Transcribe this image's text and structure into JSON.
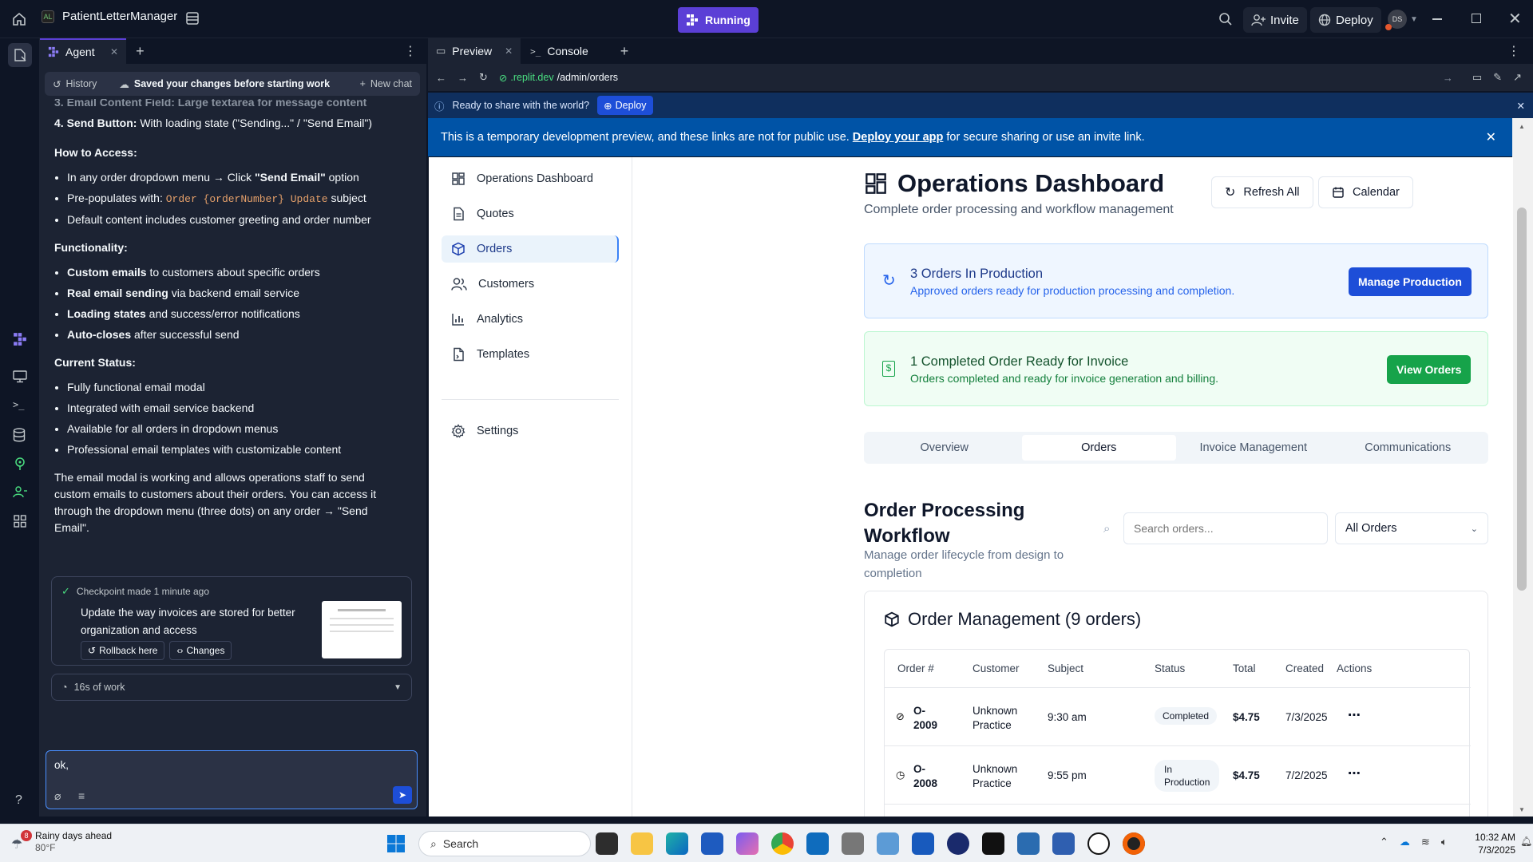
{
  "topbar": {
    "app_name": "PatientLetterManager",
    "running_label": "Running",
    "invite_label": "Invite",
    "deploy_label": "Deploy",
    "avatar_initials": "DS"
  },
  "agent": {
    "tab_label": "Agent",
    "history_label": "History",
    "saved_status": "Saved your changes before starting work",
    "new_chat_label": "New chat",
    "clipped_line": "3. Email Content Field: Large textarea for message content",
    "send_button_item_bold": "4. Send Button:",
    "send_button_item_rest": " With loading state (\"Sending...\" / \"Send Email\")",
    "how_to_access_heading": "How to Access:",
    "access_1_pre": "In any order dropdown menu → Click ",
    "access_1_bold": "\"Send Email\"",
    "access_1_post": " option",
    "access_2_pre": "Pre-populates with: ",
    "access_2_code": "Order {orderNumber} Update",
    "access_2_post": " subject",
    "access_3": "Default content includes customer greeting and order number",
    "functionality_heading": "Functionality:",
    "func_1_bold": "Custom emails",
    "func_1_rest": " to customers about specific orders",
    "func_2_bold": "Real email sending",
    "func_2_rest": " via backend email service",
    "func_3_bold": "Loading states",
    "func_3_rest": " and success/error notifications",
    "func_4_bold": "Auto-closes",
    "func_4_rest": " after successful send",
    "status_heading": "Current Status:",
    "status_1": "Fully functional email modal",
    "status_2": "Integrated with email service backend",
    "status_3": "Available for all orders in dropdown menus",
    "status_4": "Professional email templates with customizable content",
    "summary": "The email modal is working and allows operations staff to send custom emails to customers about their orders. You can access it through the dropdown menu (three dots) on any order → \"Send Email\".",
    "checkpoint_label": "Checkpoint made 1 minute ago",
    "checkpoint_desc": "Update the way invoices are stored for better organization and access",
    "rollback_label": "Rollback here",
    "changes_label": "Changes",
    "work_time": "16s of work",
    "input_value": "ok,"
  },
  "preview": {
    "preview_tab": "Preview",
    "console_tab": "Console",
    "url_domain": ".replit.dev",
    "url_path": "/admin/orders",
    "share_prompt": "Ready to share with the world?",
    "share_deploy": "Deploy",
    "banner_pre": "This is a temporary development preview, and these links are not for public use. ",
    "banner_link": "Deploy your app",
    "banner_post": " for secure sharing or use an invite link."
  },
  "app": {
    "nav": [
      "Operations Dashboard",
      "Quotes",
      "Orders",
      "Customers",
      "Analytics",
      "Templates"
    ],
    "settings_label": "Settings",
    "page_title": "Operations Dashboard",
    "page_subtitle": "Complete order processing and workflow management",
    "refresh_label": "Refresh All",
    "calendar_label": "Calendar",
    "production_title": "3 Orders In Production",
    "production_desc": "Approved orders ready for production processing and completion.",
    "production_btn": "Manage Production",
    "invoice_title": "1 Completed Order Ready for Invoice",
    "invoice_desc": "Orders completed and ready for invoice generation and billing.",
    "invoice_btn": "View Orders",
    "tabs": [
      "Overview",
      "Orders",
      "Invoice Management",
      "Communications"
    ],
    "workflow_title_1": "Order Processing",
    "workflow_title_2": "Workflow",
    "workflow_desc": "Manage order lifecycle from design to completion",
    "search_placeholder": "Search orders...",
    "filter_value": "All Orders",
    "mgmt_title": "Order Management (9 orders)",
    "columns": [
      "Order #",
      "Customer",
      "Subject",
      "Status",
      "Total",
      "Created",
      "Actions"
    ],
    "rows": [
      {
        "order_a": "O-",
        "order_b": "2009",
        "cust_a": "Unknown",
        "cust_b": "Practice",
        "subject": "9:30 am",
        "status": "Completed",
        "total": "$4.75",
        "created": "7/3/2025"
      },
      {
        "order_a": "O-",
        "order_b": "2008",
        "cust_a": "Unknown",
        "cust_b": "Practice",
        "subject": "9:55 pm",
        "status_a": "In",
        "status_b": "Production",
        "total": "$4.75",
        "created": "7/2/2025"
      }
    ]
  },
  "taskbar": {
    "weather_badge": "8",
    "weather_title": "Rainy days ahead",
    "weather_temp": "80°F",
    "search_label": "Search",
    "time": "10:32 AM",
    "date": "7/3/2025"
  },
  "colors": {
    "replit_bg": "#0e1525",
    "panel_bg": "#1c2333",
    "running_purple": "#5b3fd6",
    "banner_blue": "#0053a6",
    "primary_button": "#1d4ed8",
    "success_button": "#16a34a"
  }
}
